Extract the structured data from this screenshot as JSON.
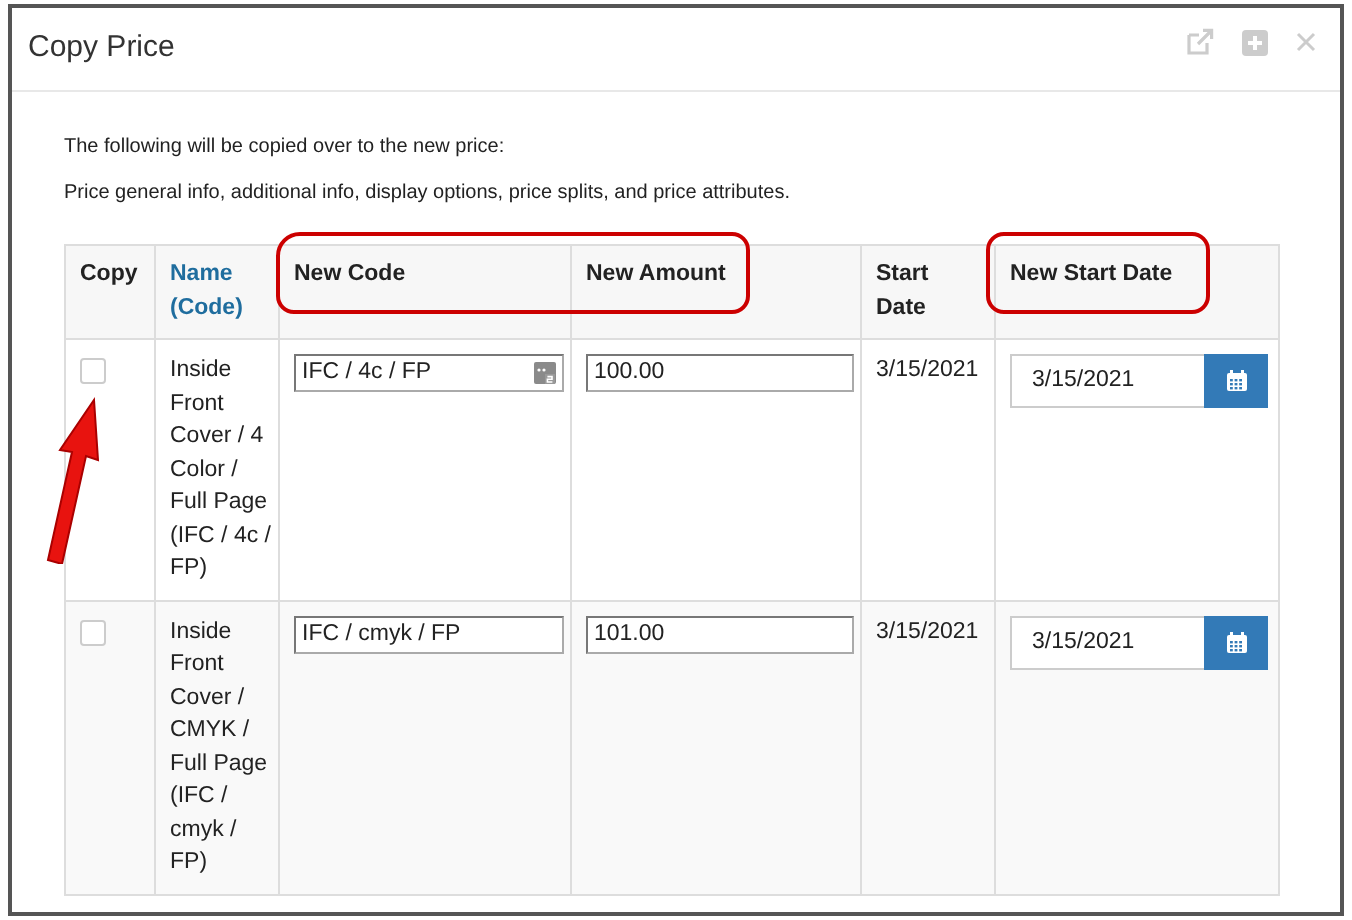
{
  "window": {
    "title": "Copy Price"
  },
  "intro": [
    "The following will be copied over to the new price:",
    "Price general info, additional info, display options, price splits, and price attributes."
  ],
  "table": {
    "columns": [
      {
        "label": "Copy",
        "kind": "plain"
      },
      {
        "label": "Name (Code)",
        "kind": "link"
      },
      {
        "label": "New Code",
        "kind": "plain"
      },
      {
        "label": "New Amount",
        "kind": "plain"
      },
      {
        "label": "Start Date",
        "kind": "plain"
      },
      {
        "label": "New Start Date",
        "kind": "plain"
      }
    ],
    "rows": [
      {
        "checked": false,
        "name": "Inside Front Cover / 4 Color / Full Page (IFC / 4c / FP)",
        "new_code": "IFC / 4c / FP",
        "code_icon": true,
        "new_amount": "100.00",
        "start_date": "3/15/2021",
        "new_start_date": "3/15/2021"
      },
      {
        "checked": false,
        "name": "Inside Front Cover / CMYK / Full Page (IFC / cmyk / FP)",
        "new_code": "IFC / cmyk / FP",
        "code_icon": false,
        "new_amount": "101.00",
        "start_date": "3/15/2021",
        "new_start_date": "3/15/2021"
      }
    ]
  }
}
